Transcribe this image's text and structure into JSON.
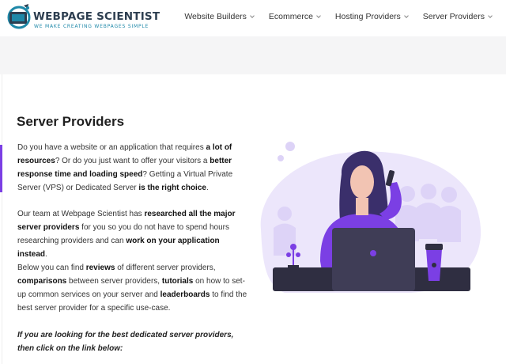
{
  "header": {
    "logo_title": "WEBPAGE SCIENTIST",
    "logo_tagline": "WE MAKE CREATING WEBPAGES SIMPLE",
    "nav": [
      {
        "label": "Website Builders",
        "icon": "chevron-down-icon"
      },
      {
        "label": "Ecommerce",
        "icon": "chevron-down-icon"
      },
      {
        "label": "Hosting Providers",
        "icon": "chevron-down-icon"
      },
      {
        "label": "Server Providers",
        "icon": "chevron-down-icon"
      }
    ]
  },
  "main": {
    "title": "Server Providers",
    "p1": {
      "t1": "Do you have a website or an application that requires ",
      "b1": "a lot of resources",
      "t2": "? Or do you just want to offer your visitors a ",
      "b2": "better response time and loading speed",
      "t3": "? Getting a Virtual Private Server (VPS) or Dedicated Server ",
      "b3": "is the right choice",
      "t4": "."
    },
    "p2": {
      "t1": "Our team at Webpage Scientist has ",
      "b1": "researched all the major server providers",
      "t2": " for you so you do not have to spend hours researching providers and can ",
      "b2": "work on your application instead",
      "t3": "."
    },
    "p3": {
      "t1": "Below you can find ",
      "b1": "reviews",
      "t2": " of different server providers, ",
      "b2": "comparisons",
      "t3": " between server providers, ",
      "b3": "tutorials",
      "t4": " on how to set-up common services on your server and ",
      "b4": "leaderboards",
      "t5": " to find the best server provider for a specific use-case."
    },
    "p4": "If you are looking for the best dedicated server providers, then click on the link below:"
  },
  "colors": {
    "accent": "#7b3fe4",
    "dark": "#2f2e41",
    "light_purple": "#ece6fb",
    "logo_blue": "#1e88a8"
  }
}
